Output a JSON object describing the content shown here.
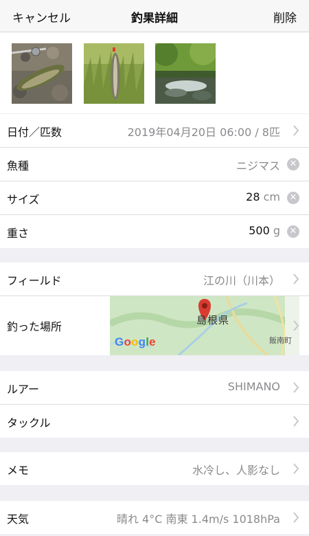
{
  "header": {
    "cancel_label": "キャンセル",
    "title": "釣果詳細",
    "delete_label": "削除"
  },
  "photos": [
    {
      "alt": "rainbow trout in water with rod"
    },
    {
      "alt": "trout hanging on grass"
    },
    {
      "alt": "mountain stream"
    }
  ],
  "catch_info": {
    "date_label": "日付／匹数",
    "date_value": "2019年04月20日 06:00 / 8匹",
    "species_label": "魚種",
    "species_value": "ニジマス",
    "size_label": "サイズ",
    "size_value": "28",
    "size_unit": "cm",
    "weight_label": "重さ",
    "weight_value": "500",
    "weight_unit": "g"
  },
  "location": {
    "field_label": "フィールド",
    "field_value": "江の川（川本）",
    "spot_label": "釣った場所",
    "map_prefecture": "島根県",
    "map_town": "飯南町",
    "map_brand": "Google"
  },
  "tackle": {
    "lure_label": "ルアー",
    "lure_value": "SHIMANO",
    "tackle_label": "タックル",
    "tackle_value": ""
  },
  "memo": {
    "label": "メモ",
    "value": "水冷し、人影なし"
  },
  "weather": {
    "label": "天気",
    "value": "晴れ 4°C 南東 1.4m/s 1018hPa"
  },
  "colors": {
    "background": "#efeff4",
    "secondary_text": "#8a8a8e",
    "map_green": "#cfe6c4",
    "map_pin": "#d93b30"
  }
}
